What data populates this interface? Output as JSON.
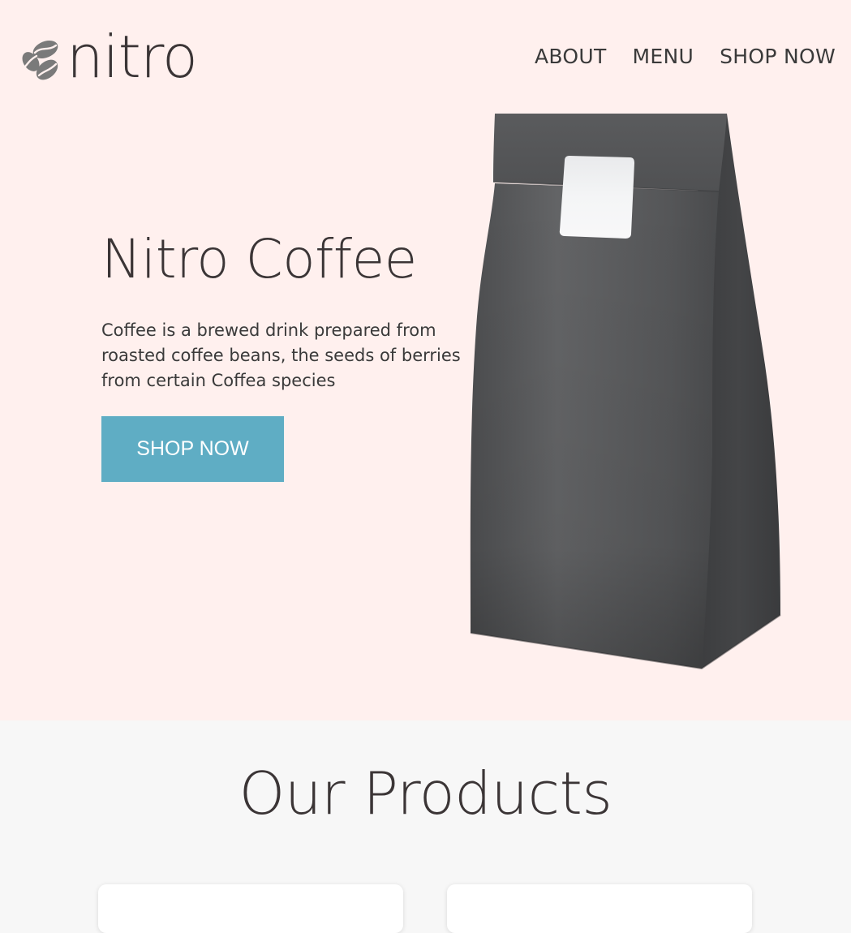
{
  "brand": {
    "name": "nitro",
    "logo_icon": "coffee-beans-icon"
  },
  "nav": {
    "items": [
      {
        "label": "ABOUT"
      },
      {
        "label": "MENU"
      },
      {
        "label": "SHOP NOW"
      }
    ]
  },
  "hero": {
    "title": "Nitro Coffee",
    "description": "Coffee is a brewed drink prepared from roasted coffee beans, the seeds of berries from certain Coffea species",
    "button_label": "SHOP NOW",
    "image": "coffee-bag-image"
  },
  "products": {
    "title": "Our Products",
    "cards": [
      {},
      {}
    ]
  },
  "colors": {
    "hero_background": "#fff0ee",
    "section_background": "#f7f7f7",
    "accent": "#5fadc4",
    "text": "#3a3a3a"
  }
}
